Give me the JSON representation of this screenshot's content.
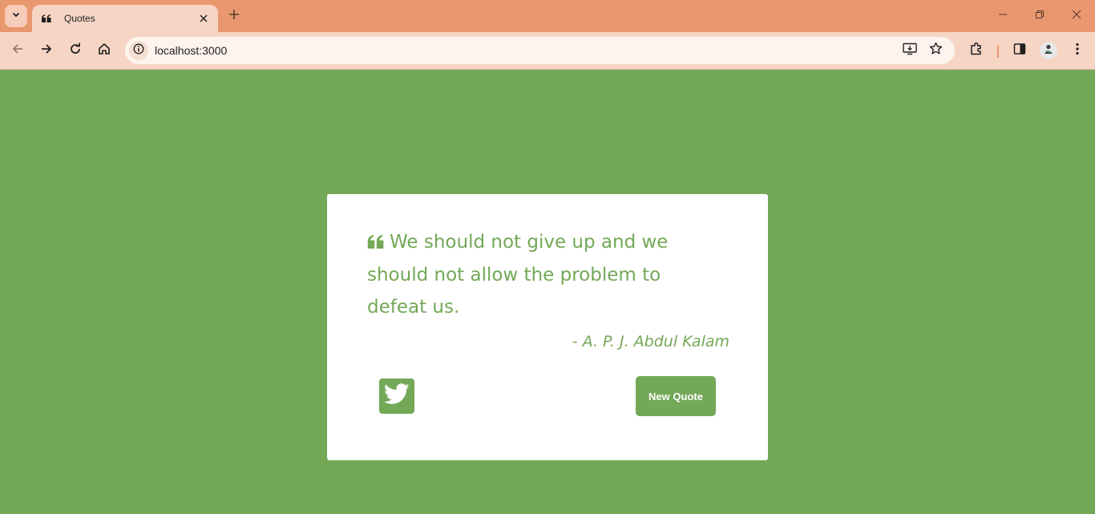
{
  "browser": {
    "tab_title": "Quotes",
    "url": "localhost:3000",
    "colors": {
      "frame": "#e9976f",
      "toolbar": "#f6d5c4",
      "omnibox": "#fff3ee"
    }
  },
  "icons": {
    "tab_search": "chevron-down-icon",
    "favicon": "quote-left-icon",
    "close": "close-icon",
    "new_tab": "plus-icon",
    "back": "arrow-left-icon",
    "forward": "arrow-right-icon",
    "reload": "reload-icon",
    "home": "home-icon",
    "site_info": "info-icon",
    "install": "install-app-icon",
    "bookmark": "star-icon",
    "extensions": "puzzle-icon",
    "side_panel": "side-panel-icon",
    "profile": "profile-avatar-icon",
    "menu": "kebab-menu-icon",
    "twitter": "twitter-icon"
  },
  "page": {
    "background_color": "#73a857",
    "quote": {
      "text": "We should not give up and we should not allow the problem to defeat us.",
      "author": "- A. P. J. Abdul Kalam"
    },
    "new_quote_label": "New Quote",
    "accent_color": "#73a857"
  }
}
